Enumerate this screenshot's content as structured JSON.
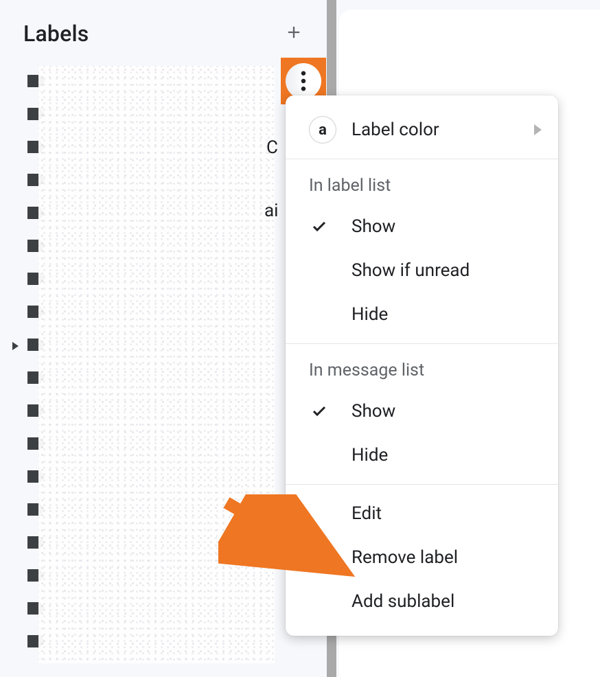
{
  "sidebar": {
    "section_title": "Labels",
    "label_count": 18,
    "expand_row_index": 8
  },
  "peek_text": {
    "c": "C",
    "ai": "ai"
  },
  "menu": {
    "label_color": "Label color",
    "sections": {
      "label_list": {
        "header": "In label list",
        "items": [
          "Show",
          "Show if unread",
          "Hide"
        ],
        "selected_index": 0
      },
      "message_list": {
        "header": "In message list",
        "items": [
          "Show",
          "Hide"
        ],
        "selected_index": 0
      }
    },
    "actions": [
      "Edit",
      "Remove label",
      "Add sublabel"
    ]
  },
  "annotation": {
    "highlight_color": "#ef7622"
  }
}
